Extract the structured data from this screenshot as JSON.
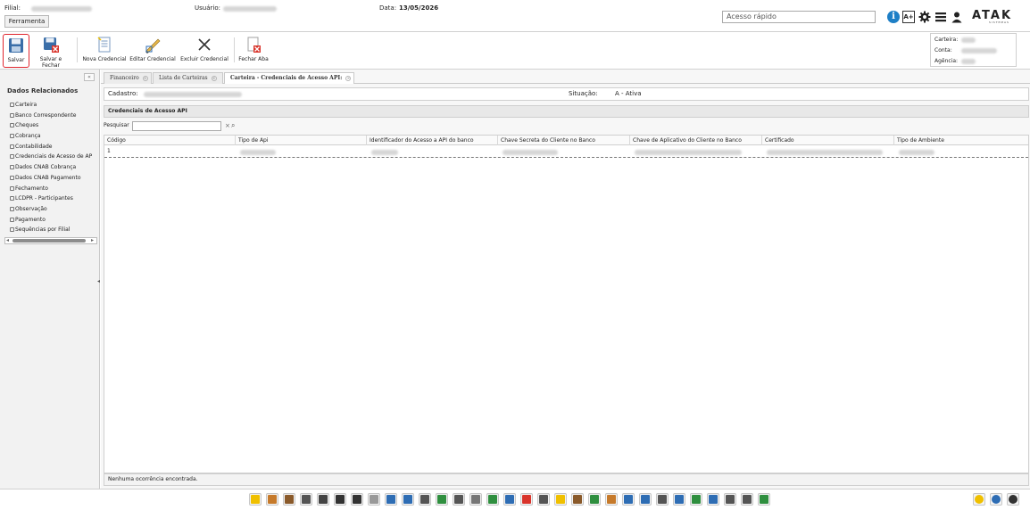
{
  "header": {
    "filial_label": "Filial:",
    "usuario_label": "Usuário:",
    "data_label": "Data:",
    "data_value": "13/05/2026",
    "ferramenta_tab": "Ferramenta",
    "quick_access_placeholder": "Acesso rápido",
    "logo": "ATAK",
    "logo_sub": "SISTEMAS",
    "font_size_label": "A+"
  },
  "toolbar": {
    "save": "Salvar",
    "save_close": "Salvar e Fechar",
    "new_credential": "Nova Credencial",
    "edit_credential": "Editar Credencial",
    "delete_credential": "Excluir Credencial",
    "close_tab": "Fechar Aba"
  },
  "info_box": {
    "carteira_label": "Carteira:",
    "conta_label": "Conta:",
    "agencia_label": "Agência:"
  },
  "sidebar": {
    "title": "Dados Relacionados",
    "collapse_label": "«",
    "items": [
      {
        "label": "Carteira"
      },
      {
        "label": "Banco Correspondente"
      },
      {
        "label": "Cheques"
      },
      {
        "label": "Cobrança"
      },
      {
        "label": "Contabilidade"
      },
      {
        "label": "Credenciais de Acesso de AP"
      },
      {
        "label": "Dados CNAB Cobrança"
      },
      {
        "label": "Dados CNAB Pagamento"
      },
      {
        "label": "Fechamento"
      },
      {
        "label": "LCDPR - Participantes"
      },
      {
        "label": "Observação"
      },
      {
        "label": "Pagamento"
      },
      {
        "label": "Sequências por Filial"
      }
    ]
  },
  "tabs": [
    {
      "label": "Financeiro"
    },
    {
      "label": "Lista de Carteiras"
    },
    {
      "label": "Carteira - Credenciais de Acesso API:"
    }
  ],
  "form": {
    "cadastro_label": "Cadastro:",
    "situacao_label": "Situação:",
    "situacao_value": "A - Ativa",
    "section_title": "Credenciais de Acesso API",
    "search_label": "Pesquisar"
  },
  "grid": {
    "columns": [
      "Código",
      "Tipo de Api",
      "Identificador do Acesso a API do banco",
      "Chave Secreta do Cliente no Banco",
      "Chave de Aplicativo do Cliente no Banco",
      "Certificado",
      "Tipo de Ambiente"
    ],
    "rows": [
      {
        "codigo": "1"
      }
    ],
    "empty_message": "Nenhuma ocorrência encontrada."
  },
  "colors": {
    "accent_red": "#e0262e",
    "info_blue": "#1e7fc6"
  },
  "dock_icons": [
    {
      "name": "star-icon",
      "color": "#f0c000"
    },
    {
      "name": "people-icon",
      "color": "#c67a2b"
    },
    {
      "name": "briefcase-icon",
      "color": "#8a5a2b"
    },
    {
      "name": "calculator-icon",
      "color": "#555555"
    },
    {
      "name": "list-icon",
      "color": "#444444"
    },
    {
      "name": "bank-icon",
      "color": "#333333"
    },
    {
      "name": "dial-icon",
      "color": "#333333"
    },
    {
      "name": "pen-icon",
      "color": "#999999"
    },
    {
      "name": "edit-doc-icon",
      "color": "#2e6db4"
    },
    {
      "name": "chart-doc-icon",
      "color": "#2e6db4"
    },
    {
      "name": "book-icon",
      "color": "#555555"
    },
    {
      "name": "globe-icon",
      "color": "#2f8f3f"
    },
    {
      "name": "bottle-icon",
      "color": "#555555"
    },
    {
      "name": "truck-icon",
      "color": "#777777"
    },
    {
      "name": "dollar-icon",
      "color": "#2f8f3f"
    },
    {
      "name": "monitor-icon",
      "color": "#2e6db4"
    },
    {
      "name": "bar-chart-icon",
      "color": "#d9342b"
    },
    {
      "name": "factory-icon",
      "color": "#555555"
    },
    {
      "name": "bulb-icon",
      "color": "#f0c000"
    },
    {
      "name": "cow-icon",
      "color": "#8a5a2b"
    },
    {
      "name": "plant-icon",
      "color": "#2f8f3f"
    },
    {
      "name": "gear-icon",
      "color": "#c67a2b"
    },
    {
      "name": "doc-icon",
      "color": "#2e6db4"
    },
    {
      "name": "diamond-icon",
      "color": "#2e6db4"
    },
    {
      "name": "percent-icon",
      "color": "#555555"
    },
    {
      "name": "table-icon",
      "color": "#2e6db4"
    },
    {
      "name": "worker-icon",
      "color": "#2f8f3f"
    },
    {
      "name": "cart-icon",
      "color": "#2e6db4"
    },
    {
      "name": "network-icon",
      "color": "#555555"
    },
    {
      "name": "headset-icon",
      "color": "#555555"
    },
    {
      "name": "rocket-icon",
      "color": "#2f8f3f"
    }
  ],
  "right_icons": [
    {
      "name": "favorites-icon",
      "color": "#f0c000"
    },
    {
      "name": "help-icon",
      "color": "#2e6db4"
    },
    {
      "name": "video-icon",
      "color": "#333333"
    }
  ]
}
